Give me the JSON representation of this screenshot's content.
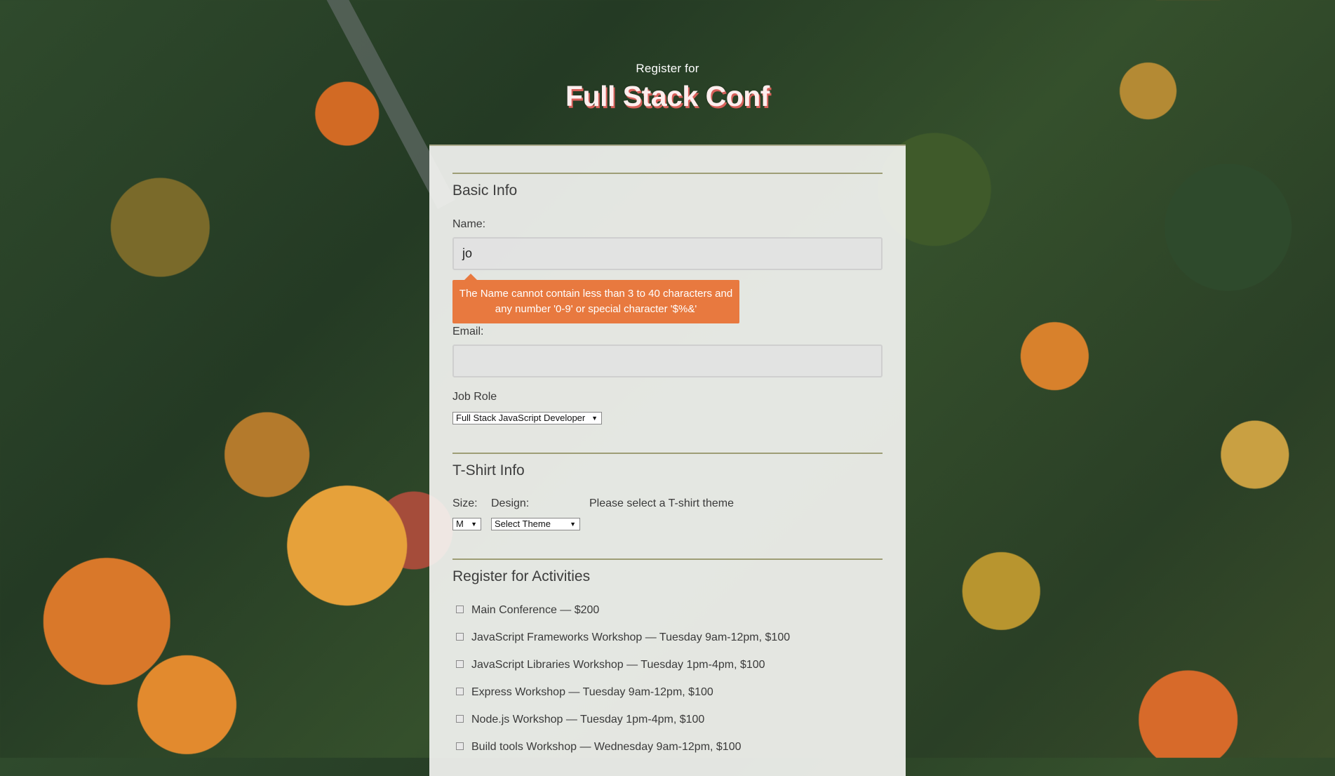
{
  "header": {
    "pre_title": "Register for",
    "title": "Full Stack Conf"
  },
  "basic_info": {
    "heading": "Basic Info",
    "name_label": "Name:",
    "name_value": "jo",
    "name_error": "The Name cannot contain less than 3 to 40 characters and any number '0-9' or special character '$%&'",
    "email_label": "Email:",
    "email_value": "",
    "job_role_label": "Job Role",
    "job_role_selected": "Full Stack JavaScript Developer"
  },
  "tshirt_info": {
    "heading": "T-Shirt Info",
    "size_label": "Size:",
    "size_selected": "M",
    "design_label": "Design:",
    "design_selected": "Select Theme",
    "design_hint": "Please select a T-shirt theme"
  },
  "activities": {
    "heading": "Register for Activities",
    "items": [
      {
        "label": "Main Conference — $200",
        "checked": false
      },
      {
        "label": "JavaScript Frameworks Workshop — Tuesday 9am-12pm, $100",
        "checked": false
      },
      {
        "label": "JavaScript Libraries Workshop — Tuesday 1pm-4pm, $100",
        "checked": false
      },
      {
        "label": "Express Workshop — Tuesday 9am-12pm, $100",
        "checked": false
      },
      {
        "label": "Node.js Workshop — Tuesday 1pm-4pm, $100",
        "checked": false
      },
      {
        "label": "Build tools Workshop — Wednesday 9am-12pm, $100",
        "checked": false
      }
    ]
  },
  "colors": {
    "title_shadow": "#d8605a",
    "error_background": "#e8793f",
    "section_rule": "#9e9e76"
  }
}
